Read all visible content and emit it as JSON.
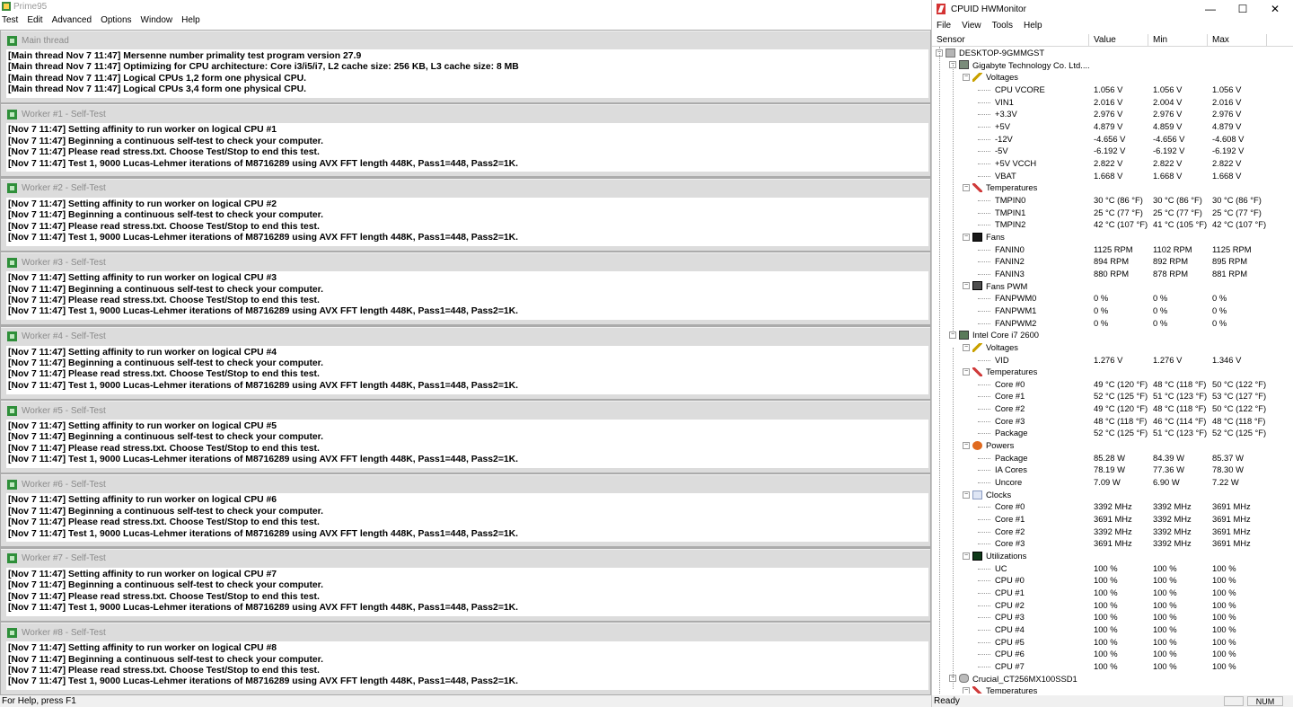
{
  "prime95": {
    "title": "Prime95",
    "menu": [
      "Test",
      "Edit",
      "Advanced",
      "Options",
      "Window",
      "Help"
    ],
    "status": "For Help, press F1",
    "windows": [
      {
        "title": "Main thread",
        "lines": [
          "[Main thread Nov 7 11:47] Mersenne number primality test program version 27.9",
          "[Main thread Nov 7 11:47] Optimizing for CPU architecture: Core i3/i5/i7, L2 cache size: 256 KB, L3 cache size: 8 MB",
          "[Main thread Nov 7 11:47] Logical CPUs 1,2 form one physical CPU.",
          "[Main thread Nov 7 11:47] Logical CPUs 3,4 form one physical CPU."
        ]
      },
      {
        "title": "Worker #1 - Self-Test",
        "lines": [
          "[Nov 7 11:47] Setting affinity to run worker on logical CPU #1",
          "[Nov 7 11:47] Beginning a continuous self-test to check your computer.",
          "[Nov 7 11:47] Please read stress.txt.  Choose Test/Stop to end this test.",
          "[Nov 7 11:47] Test 1, 9000 Lucas-Lehmer iterations of M8716289 using AVX FFT length 448K, Pass1=448, Pass2=1K."
        ]
      },
      {
        "title": "Worker #2 - Self-Test",
        "lines": [
          "[Nov 7 11:47] Setting affinity to run worker on logical CPU #2",
          "[Nov 7 11:47] Beginning a continuous self-test to check your computer.",
          "[Nov 7 11:47] Please read stress.txt.  Choose Test/Stop to end this test.",
          "[Nov 7 11:47] Test 1, 9000 Lucas-Lehmer iterations of M8716289 using AVX FFT length 448K, Pass1=448, Pass2=1K."
        ]
      },
      {
        "title": "Worker #3 - Self-Test",
        "lines": [
          "[Nov 7 11:47] Setting affinity to run worker on logical CPU #3",
          "[Nov 7 11:47] Beginning a continuous self-test to check your computer.",
          "[Nov 7 11:47] Please read stress.txt.  Choose Test/Stop to end this test.",
          "[Nov 7 11:47] Test 1, 9000 Lucas-Lehmer iterations of M8716289 using AVX FFT length 448K, Pass1=448, Pass2=1K."
        ]
      },
      {
        "title": "Worker #4 - Self-Test",
        "lines": [
          "[Nov 7 11:47] Setting affinity to run worker on logical CPU #4",
          "[Nov 7 11:47] Beginning a continuous self-test to check your computer.",
          "[Nov 7 11:47] Please read stress.txt.  Choose Test/Stop to end this test.",
          "[Nov 7 11:47] Test 1, 9000 Lucas-Lehmer iterations of M8716289 using AVX FFT length 448K, Pass1=448, Pass2=1K."
        ]
      },
      {
        "title": "Worker #5 - Self-Test",
        "lines": [
          "[Nov 7 11:47] Setting affinity to run worker on logical CPU #5",
          "[Nov 7 11:47] Beginning a continuous self-test to check your computer.",
          "[Nov 7 11:47] Please read stress.txt.  Choose Test/Stop to end this test.",
          "[Nov 7 11:47] Test 1, 9000 Lucas-Lehmer iterations of M8716289 using AVX FFT length 448K, Pass1=448, Pass2=1K."
        ]
      },
      {
        "title": "Worker #6 - Self-Test",
        "lines": [
          "[Nov 7 11:47] Setting affinity to run worker on logical CPU #6",
          "[Nov 7 11:47] Beginning a continuous self-test to check your computer.",
          "[Nov 7 11:47] Please read stress.txt.  Choose Test/Stop to end this test.",
          "[Nov 7 11:47] Test 1, 9000 Lucas-Lehmer iterations of M8716289 using AVX FFT length 448K, Pass1=448, Pass2=1K."
        ]
      },
      {
        "title": "Worker #7 - Self-Test",
        "lines": [
          "[Nov 7 11:47] Setting affinity to run worker on logical CPU #7",
          "[Nov 7 11:47] Beginning a continuous self-test to check your computer.",
          "[Nov 7 11:47] Please read stress.txt.  Choose Test/Stop to end this test.",
          "[Nov 7 11:47] Test 1, 9000 Lucas-Lehmer iterations of M8716289 using AVX FFT length 448K, Pass1=448, Pass2=1K."
        ]
      },
      {
        "title": "Worker #8 - Self-Test",
        "lines": [
          "[Nov 7 11:47] Setting affinity to run worker on logical CPU #8",
          "[Nov 7 11:47] Beginning a continuous self-test to check your computer.",
          "[Nov 7 11:47] Please read stress.txt.  Choose Test/Stop to end this test.",
          "[Nov 7 11:47] Test 1, 9000 Lucas-Lehmer iterations of M8716289 using AVX FFT length 448K, Pass1=448, Pass2=1K."
        ]
      }
    ]
  },
  "hwmonitor": {
    "title": "CPUID HWMonitor",
    "window_controls": [
      "—",
      "☐",
      "✕"
    ],
    "menu": [
      "File",
      "View",
      "Tools",
      "Help"
    ],
    "columns": [
      "Sensor",
      "Value",
      "Min",
      "Max"
    ],
    "status": "Ready",
    "status_num": "NUM",
    "rows": [
      {
        "level": 0,
        "exp": "−",
        "icon": "computer-icon",
        "label": "DESKTOP-9GMMGST"
      },
      {
        "level": 1,
        "exp": "−",
        "icon": "motherboard-icon",
        "label": "Gigabyte Technology Co. Ltd...."
      },
      {
        "level": 2,
        "exp": "−",
        "icon": "voltage-icon",
        "label": "Voltages"
      },
      {
        "level": 3,
        "label": "CPU VCORE",
        "value": "1.056 V",
        "min": "1.056 V",
        "max": "1.056 V"
      },
      {
        "level": 3,
        "label": "VIN1",
        "value": "2.016 V",
        "min": "2.004 V",
        "max": "2.016 V"
      },
      {
        "level": 3,
        "label": "+3.3V",
        "value": "2.976 V",
        "min": "2.976 V",
        "max": "2.976 V"
      },
      {
        "level": 3,
        "label": "+5V",
        "value": "4.879 V",
        "min": "4.859 V",
        "max": "4.879 V"
      },
      {
        "level": 3,
        "label": "-12V",
        "value": "-4.656 V",
        "min": "-4.656 V",
        "max": "-4.608 V"
      },
      {
        "level": 3,
        "label": "-5V",
        "value": "-6.192 V",
        "min": "-6.192 V",
        "max": "-6.192 V"
      },
      {
        "level": 3,
        "label": "+5V VCCH",
        "value": "2.822 V",
        "min": "2.822 V",
        "max": "2.822 V"
      },
      {
        "level": 3,
        "label": "VBAT",
        "value": "1.668 V",
        "min": "1.668 V",
        "max": "1.668 V"
      },
      {
        "level": 2,
        "exp": "−",
        "icon": "thermometer-icon",
        "label": "Temperatures"
      },
      {
        "level": 3,
        "label": "TMPIN0",
        "value": "30 °C  (86 °F)",
        "min": "30 °C  (86 °F)",
        "max": "30 °C  (86 °F)"
      },
      {
        "level": 3,
        "label": "TMPIN1",
        "value": "25 °C  (77 °F)",
        "min": "25 °C  (77 °F)",
        "max": "25 °C  (77 °F)"
      },
      {
        "level": 3,
        "label": "TMPIN2",
        "value": "42 °C  (107 °F)",
        "min": "41 °C  (105 °F)",
        "max": "42 °C  (107 °F)"
      },
      {
        "level": 2,
        "exp": "−",
        "icon": "fan-icon",
        "label": "Fans"
      },
      {
        "level": 3,
        "label": "FANIN0",
        "value": "1125 RPM",
        "min": "1102 RPM",
        "max": "1125 RPM"
      },
      {
        "level": 3,
        "label": "FANIN2",
        "value": "894 RPM",
        "min": "892 RPM",
        "max": "895 RPM"
      },
      {
        "level": 3,
        "label": "FANIN3",
        "value": "880 RPM",
        "min": "878 RPM",
        "max": "881 RPM"
      },
      {
        "level": 2,
        "exp": "−",
        "icon": "fan-pwm-icon",
        "label": "Fans PWM"
      },
      {
        "level": 3,
        "label": "FANPWM0",
        "value": "0 %",
        "min": "0 %",
        "max": "0 %"
      },
      {
        "level": 3,
        "label": "FANPWM1",
        "value": "0 %",
        "min": "0 %",
        "max": "0 %"
      },
      {
        "level": 3,
        "label": "FANPWM2",
        "value": "0 %",
        "min": "0 %",
        "max": "0 %"
      },
      {
        "level": 1,
        "exp": "−",
        "icon": "cpu-icon",
        "label": "Intel Core i7 2600"
      },
      {
        "level": 2,
        "exp": "−",
        "icon": "voltage-icon",
        "label": "Voltages"
      },
      {
        "level": 3,
        "label": "VID",
        "value": "1.276 V",
        "min": "1.276 V",
        "max": "1.346 V"
      },
      {
        "level": 2,
        "exp": "−",
        "icon": "thermometer-icon",
        "label": "Temperatures"
      },
      {
        "level": 3,
        "label": "Core #0",
        "value": "49 °C  (120 °F)",
        "min": "48 °C  (118 °F)",
        "max": "50 °C  (122 °F)"
      },
      {
        "level": 3,
        "label": "Core #1",
        "value": "52 °C  (125 °F)",
        "min": "51 °C  (123 °F)",
        "max": "53 °C  (127 °F)"
      },
      {
        "level": 3,
        "label": "Core #2",
        "value": "49 °C  (120 °F)",
        "min": "48 °C  (118 °F)",
        "max": "50 °C  (122 °F)"
      },
      {
        "level": 3,
        "label": "Core #3",
        "value": "48 °C  (118 °F)",
        "min": "46 °C  (114 °F)",
        "max": "48 °C  (118 °F)"
      },
      {
        "level": 3,
        "label": "Package",
        "value": "52 °C  (125 °F)",
        "min": "51 °C  (123 °F)",
        "max": "52 °C  (125 °F)"
      },
      {
        "level": 2,
        "exp": "−",
        "icon": "power-icon",
        "label": "Powers"
      },
      {
        "level": 3,
        "label": "Package",
        "value": "85.28 W",
        "min": "84.39 W",
        "max": "85.37 W"
      },
      {
        "level": 3,
        "label": "IA Cores",
        "value": "78.19 W",
        "min": "77.36 W",
        "max": "78.30 W"
      },
      {
        "level": 3,
        "label": "Uncore",
        "value": "7.09 W",
        "min": "6.90 W",
        "max": "7.22 W"
      },
      {
        "level": 2,
        "exp": "−",
        "icon": "clock-icon",
        "label": "Clocks"
      },
      {
        "level": 3,
        "label": "Core #0",
        "value": "3392 MHz",
        "min": "3392 MHz",
        "max": "3691 MHz"
      },
      {
        "level": 3,
        "label": "Core #1",
        "value": "3691 MHz",
        "min": "3392 MHz",
        "max": "3691 MHz"
      },
      {
        "level": 3,
        "label": "Core #2",
        "value": "3392 MHz",
        "min": "3392 MHz",
        "max": "3691 MHz"
      },
      {
        "level": 3,
        "label": "Core #3",
        "value": "3691 MHz",
        "min": "3392 MHz",
        "max": "3691 MHz"
      },
      {
        "level": 2,
        "exp": "−",
        "icon": "utilization-icon",
        "label": "Utilizations"
      },
      {
        "level": 3,
        "label": "UC",
        "value": "100 %",
        "min": "100 %",
        "max": "100 %"
      },
      {
        "level": 3,
        "label": "CPU #0",
        "value": "100 %",
        "min": "100 %",
        "max": "100 %"
      },
      {
        "level": 3,
        "label": "CPU #1",
        "value": "100 %",
        "min": "100 %",
        "max": "100 %"
      },
      {
        "level": 3,
        "label": "CPU #2",
        "value": "100 %",
        "min": "100 %",
        "max": "100 %"
      },
      {
        "level": 3,
        "label": "CPU #3",
        "value": "100 %",
        "min": "100 %",
        "max": "100 %"
      },
      {
        "level": 3,
        "label": "CPU #4",
        "value": "100 %",
        "min": "100 %",
        "max": "100 %"
      },
      {
        "level": 3,
        "label": "CPU #5",
        "value": "100 %",
        "min": "100 %",
        "max": "100 %"
      },
      {
        "level": 3,
        "label": "CPU #6",
        "value": "100 %",
        "min": "100 %",
        "max": "100 %"
      },
      {
        "level": 3,
        "label": "CPU #7",
        "value": "100 %",
        "min": "100 %",
        "max": "100 %"
      },
      {
        "level": 1,
        "exp": "−",
        "icon": "ssd-icon",
        "label": "Crucial_CT256MX100SSD1"
      },
      {
        "level": 2,
        "exp": "−",
        "icon": "thermometer-icon",
        "label": "Temperatures"
      }
    ]
  }
}
